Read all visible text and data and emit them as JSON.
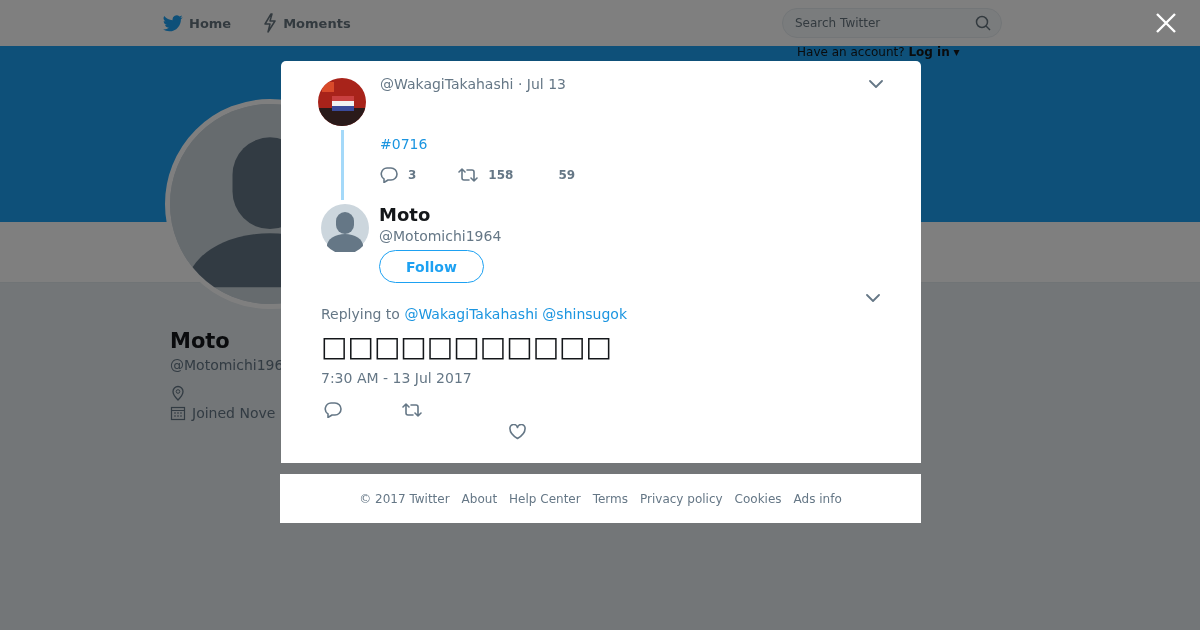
{
  "nav": {
    "items": [
      {
        "label": "Home",
        "kind": "bird"
      },
      {
        "label": "Moments",
        "kind": "bolt"
      }
    ],
    "search": {
      "placeholder": "Search Twitter"
    },
    "account": {
      "prompt": "Have an account?",
      "login": "Log in",
      "login_caret": "▾"
    }
  },
  "profile": {
    "name": "Moto",
    "handle": "@Motomichi196",
    "joined": "Joined Nove"
  },
  "conversation": {
    "parent": {
      "handle": "@WakagiTakahashi",
      "date": "· Jul 13",
      "hashtag": "#0716",
      "replies": "3",
      "retweets": "158",
      "likes": "59"
    },
    "tweet": {
      "name": "Moto",
      "handle": "@Motomichi1964",
      "follow": "Follow",
      "replying_label": "Replying to",
      "replying_to": [
        "@WakagiTakahashi",
        "@shinsugok"
      ],
      "text": "□□□□□□□□□□□",
      "time": "7:30 AM - 13 Jul 2017"
    }
  },
  "footer": [
    "© 2017 Twitter",
    "About",
    "Help Center",
    "Terms",
    "Privacy policy",
    "Cookies",
    "Ads info"
  ]
}
